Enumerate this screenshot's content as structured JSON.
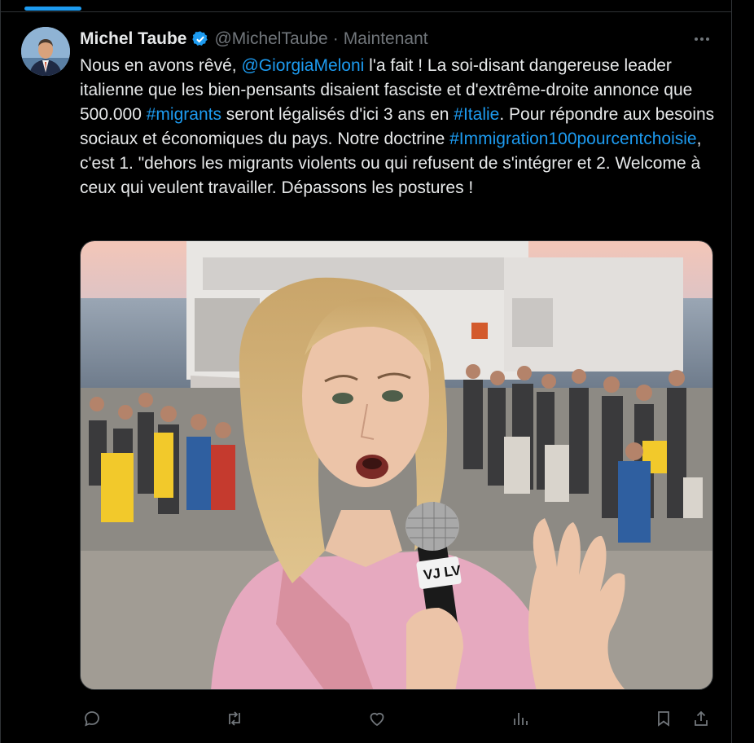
{
  "tweet": {
    "author_name": "Michel Taube",
    "handle": "@MichelTaube",
    "separator": "·",
    "time": "Maintenant",
    "text_segments": [
      {
        "text": "Nous en avons rêvé, ",
        "link": false
      },
      {
        "text": "@GiorgiaMeloni",
        "link": true
      },
      {
        "text": " l'a fait ! La soi-disant dangereuse leader italienne  que les bien-pensants disaient fasciste et d'extrême-droite annonce que 500.000 ",
        "link": false
      },
      {
        "text": "#migrants",
        "link": true
      },
      {
        "text": " seront légalisés d'ici 3 ans en ",
        "link": false
      },
      {
        "text": "#Italie",
        "link": true
      },
      {
        "text": ". Pour répondre aux besoins sociaux et économiques du pays. Notre doctrine ",
        "link": false
      },
      {
        "text": "#Immigration100pourcentchoisie",
        "link": true
      },
      {
        "text": ", c'est 1. \"dehors les migrants violents ou qui refusent de s'intégrer et 2. Welcome à ceux qui veulent travailler. Dépassons les postures !",
        "link": false
      }
    ],
    "media": {
      "microphone_text": "VJ LV"
    }
  },
  "actions": {
    "reply": "reply-icon",
    "retweet": "retweet-icon",
    "like": "heart-icon",
    "views": "views-icon",
    "bookmark": "bookmark-icon",
    "share": "share-icon"
  },
  "colors": {
    "link": "#1d9bf0",
    "muted": "#71767b",
    "background": "#000000",
    "border": "#2f3336"
  }
}
